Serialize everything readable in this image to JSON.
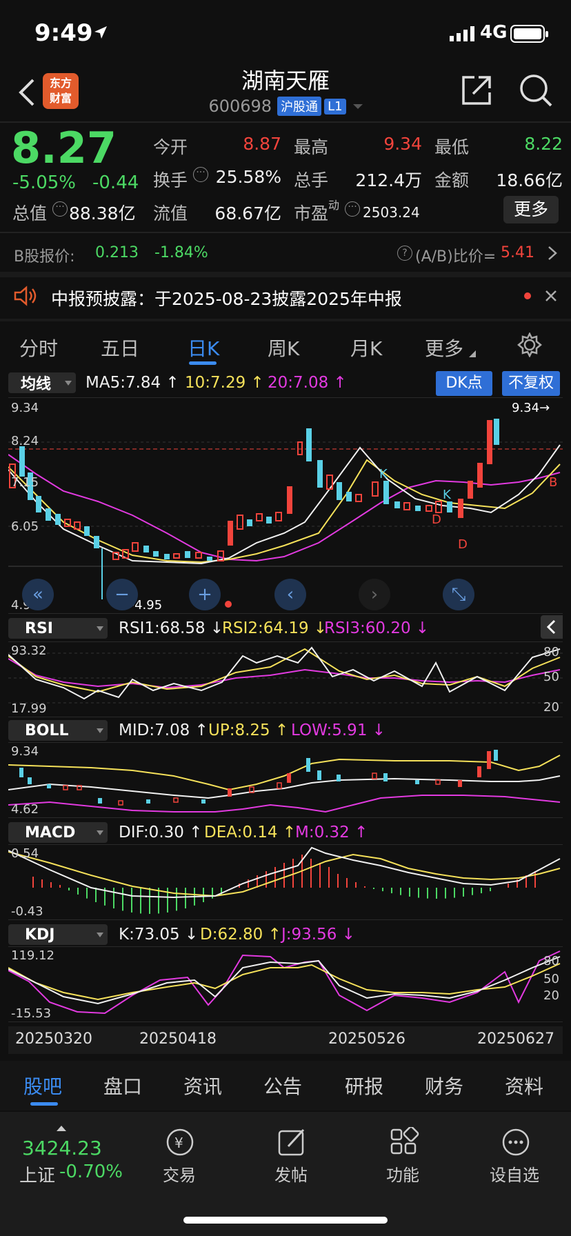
{
  "status": {
    "time": "9:49",
    "network": "4G"
  },
  "header": {
    "title": "湖南天雁",
    "code": "600698",
    "tag1": "沪股通",
    "tag2": "L1"
  },
  "quote": {
    "price": "8.27",
    "pct": "-5.05%",
    "chg": "-0.44",
    "open_label": "今开",
    "open": "8.87",
    "high_label": "最高",
    "high": "9.34",
    "low_label": "最低",
    "low": "8.22",
    "turnover_label": "换手",
    "turnover": "25.58%",
    "vol_label": "总手",
    "vol": "212.4万",
    "amount_label": "金额",
    "amount": "18.66亿",
    "mktcap_label": "总值",
    "mktcap": "88.38亿",
    "float_label": "流值",
    "float": "68.67亿",
    "pe_label": "市盈",
    "pe_sup": "动",
    "pe": "2503.24",
    "more_label": "更多"
  },
  "bshare": {
    "label": "B股报价:",
    "price": "0.213",
    "pct": "-1.84%",
    "ratio_label": "(A/B)比价=",
    "ratio": "5.41"
  },
  "notice": {
    "text": "中报预披露：于2025-08-23披露2025年中报"
  },
  "ktabs": [
    "分时",
    "五日",
    "日K",
    "周K",
    "月K",
    "更多"
  ],
  "main_chart": {
    "selector": "均线",
    "ma5": "MA5:7.84",
    "ma10": "10:7.29",
    "ma20": "20:7.08",
    "dk_btn": "DK点",
    "fq_btn": "不复权",
    "y_top": "9.34",
    "y_mid": "8.24",
    "y_mid2": "7.15",
    "y_low": "6.05",
    "y_bot": "4.95",
    "max_marker": "9.34→",
    "min_marker": "←4.95"
  },
  "rsi": {
    "name": "RSI",
    "rsi1": "RSI1:68.58",
    "rsi2": "RSI2:64.19",
    "rsi3": "RSI3:60.20",
    "top": "93.32",
    "bot": "17.99",
    "l80": "80",
    "l50": "50",
    "l20": "20"
  },
  "boll": {
    "name": "BOLL",
    "mid": "MID:7.08",
    "up": "UP:8.25",
    "low": "LOW:5.91",
    "top": "9.34",
    "bot": "4.62"
  },
  "macd": {
    "name": "MACD",
    "dif": "DIF:0.30",
    "dea": "DEA:0.14",
    "m": "M:0.32",
    "top": "0.54",
    "bot": "-0.43"
  },
  "kdj": {
    "name": "KDJ",
    "k": "K:73.05",
    "d": "D:62.80",
    "j": "J:93.56",
    "top": "119.12",
    "bot": "-15.53",
    "l80": "80",
    "l50": "50",
    "l20": "20"
  },
  "dates": [
    "20250320",
    "20250418",
    "20250526",
    "20250627"
  ],
  "bottom_tabs": [
    "股吧",
    "盘口",
    "资讯",
    "公告",
    "研报",
    "财务",
    "资料"
  ],
  "index": {
    "value": "3424.23",
    "name": "上证",
    "pct": "-0.70%"
  },
  "nav": [
    "交易",
    "发帖",
    "功能",
    "设自选"
  ]
}
